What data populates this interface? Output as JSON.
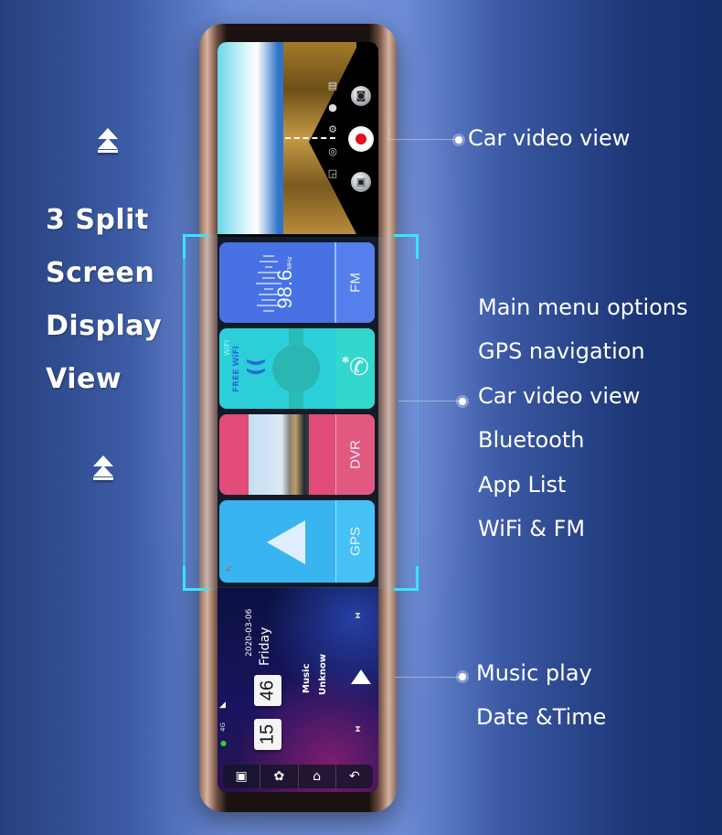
{
  "left_panel": {
    "title_lines": [
      "3 Split",
      "Screen",
      "Display",
      "View"
    ],
    "arrow_icons": [
      "double-arrow-up-icon",
      "double-arrow-up-icon"
    ]
  },
  "callouts": {
    "top": "Car video view",
    "middle_list": [
      "Main menu options",
      "GPS navigation",
      "Car video view",
      "Bluetooth",
      "App List",
      "WiFi & FM"
    ],
    "bottom": [
      "Music play",
      "Date &Time"
    ]
  },
  "device": {
    "camera_view": {
      "controls": [
        "camera-switch-icon",
        "mic-icon",
        "gear-icon",
        "lock-icon",
        "gallery-icon"
      ],
      "buttons": [
        "snapshot-button",
        "record-button",
        "playback-button"
      ],
      "record_color": "#e3101c"
    },
    "menu_tiles": [
      {
        "label": "FM",
        "frequency": "98.6",
        "unit": "MHz",
        "color": "#4168e0"
      },
      {
        "label": "",
        "wifi_tag": "WIFI",
        "wifi_text": "FREE WiFi",
        "bt_symbol": "✱",
        "color": "#22d3d3"
      },
      {
        "label": "DVR",
        "color": "#f03e66"
      },
      {
        "label": "GPS",
        "color": "#2fb6f0"
      }
    ],
    "home": {
      "date": "2020-03-06",
      "weekday": "Friday",
      "hour": "15",
      "minute": "46",
      "music_title": "Music",
      "music_artist": "Unknow",
      "network": "4G",
      "nav_buttons": [
        "▣",
        "✿",
        "⌂",
        "↶"
      ]
    }
  },
  "colors": {
    "highlight": "#38e4ff"
  }
}
